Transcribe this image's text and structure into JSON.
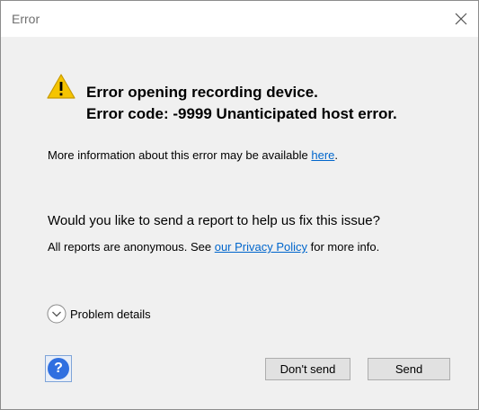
{
  "window": {
    "title": "Error"
  },
  "error": {
    "line1": "Error opening recording device.",
    "line2": "Error code: -9999 Unanticipated host error."
  },
  "info": {
    "prefix": "More information about this error may be available ",
    "link": "here",
    "suffix": "."
  },
  "report": {
    "question": "Would you like to send a report to help us fix this issue?",
    "prefix": "All reports are anonymous. See ",
    "link": "our Privacy Policy",
    "suffix": " for more info."
  },
  "details": {
    "label": "Problem details"
  },
  "help": {
    "glyph": "?"
  },
  "buttons": {
    "dont_send": "Don't send",
    "send": "Send"
  },
  "icons": {
    "close": "close-icon",
    "warning": "warning-icon",
    "expand": "chevron-down-icon",
    "help": "help-icon"
  },
  "colors": {
    "link": "#0066cc",
    "warning": "#f5c400",
    "help": "#2f6fe0"
  }
}
